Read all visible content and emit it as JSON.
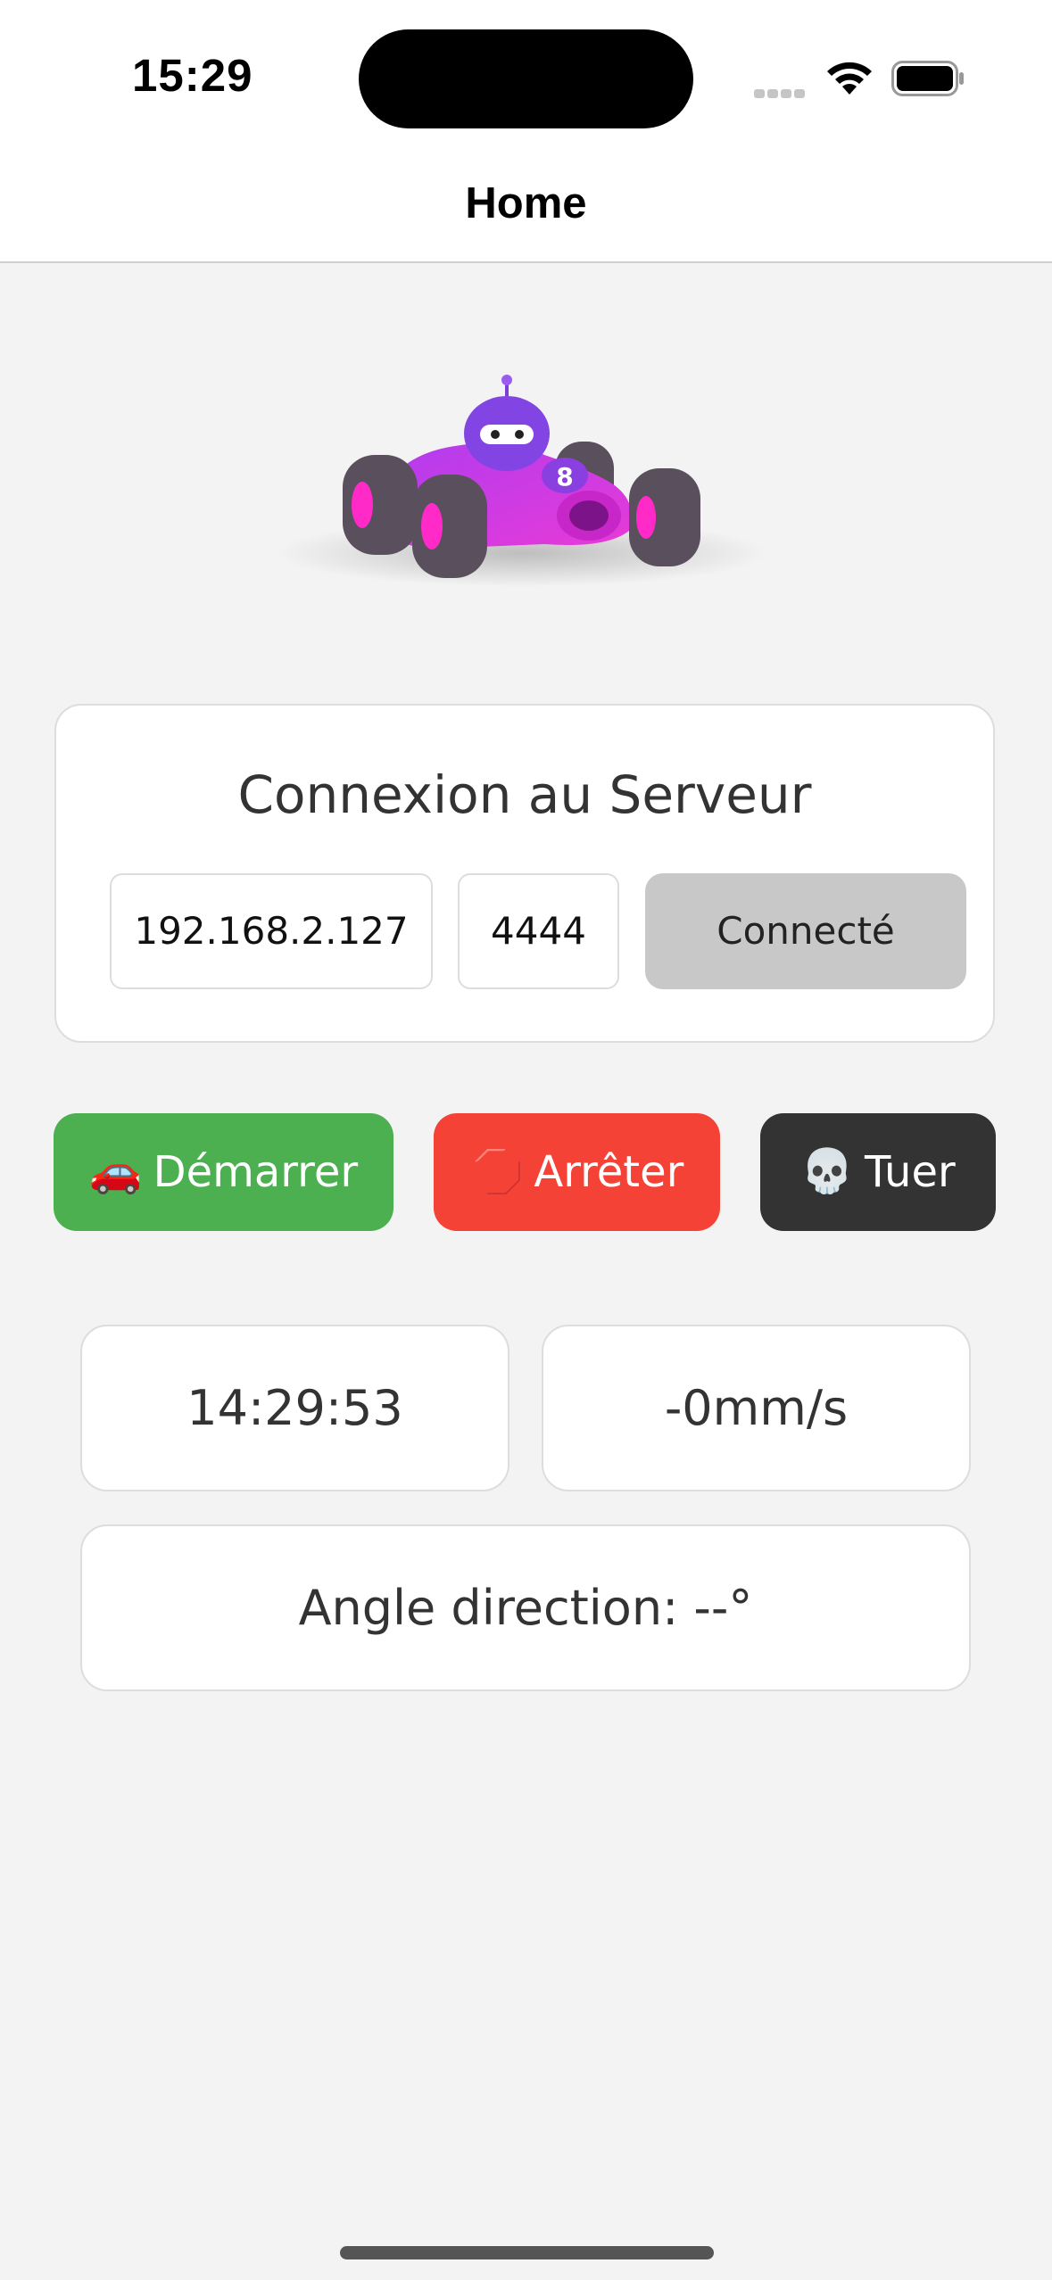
{
  "status_bar": {
    "time": "15:29"
  },
  "nav": {
    "title": "Home"
  },
  "illustration": {
    "icon": "race-car-robot-illustration",
    "number": "8"
  },
  "connection": {
    "title": "Connexion au Serveur",
    "ip_value": "192.168.2.127",
    "port_value": "4444",
    "connect_label": "Connecté"
  },
  "actions": {
    "start": {
      "emoji": "🚗",
      "label": "Démarrer",
      "color": "#4caf50"
    },
    "stop": {
      "emoji": "🛑",
      "label": "Arrêter",
      "color": "#f44236"
    },
    "kill": {
      "emoji": "💀",
      "label": "Tuer",
      "color": "#333333"
    }
  },
  "telemetry": {
    "time": "14:29:53",
    "speed": "-0mm/s",
    "angle": "Angle direction: --°"
  }
}
